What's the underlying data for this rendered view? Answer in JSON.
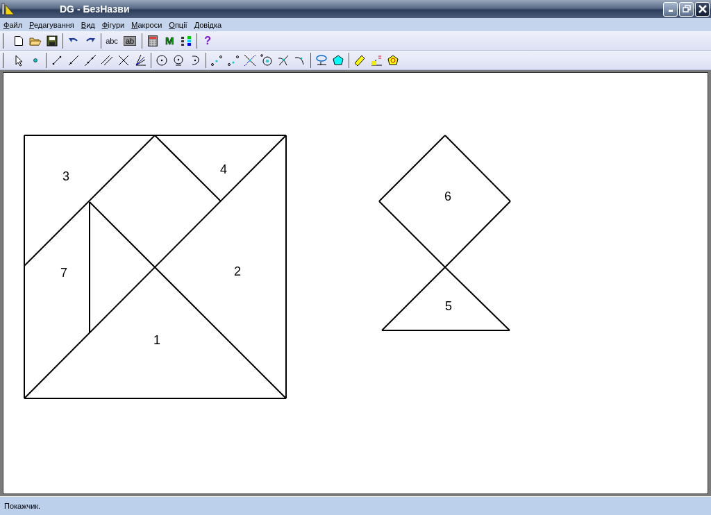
{
  "window": {
    "title": "DG - БезНазви"
  },
  "menu": [
    "Файл",
    "Редагування",
    "Вид",
    "Фігури",
    "Макроси",
    "Опції",
    "Довідка"
  ],
  "toolbar_1": [
    {
      "kind": "new"
    },
    {
      "kind": "open"
    },
    {
      "kind": "save"
    },
    {
      "kind": "sep"
    },
    {
      "kind": "undo"
    },
    {
      "kind": "redo"
    },
    {
      "kind": "sep"
    },
    {
      "kind": "text",
      "label": "abc"
    },
    {
      "kind": "textbox",
      "label": "ab"
    },
    {
      "kind": "sep"
    },
    {
      "kind": "calc"
    },
    {
      "kind": "letter",
      "label": "M"
    },
    {
      "kind": "fkeys"
    },
    {
      "kind": "sep"
    },
    {
      "kind": "help",
      "label": "?"
    }
  ],
  "toolbar_2": [
    {
      "kind": "pointer"
    },
    {
      "kind": "point"
    },
    {
      "kind": "sep"
    },
    {
      "kind": "segment"
    },
    {
      "kind": "ray"
    },
    {
      "kind": "line"
    },
    {
      "kind": "parallel"
    },
    {
      "kind": "perpendicular"
    },
    {
      "kind": "bisector"
    },
    {
      "kind": "sep"
    },
    {
      "kind": "circle"
    },
    {
      "kind": "circle-point"
    },
    {
      "kind": "arc"
    },
    {
      "kind": "sep"
    },
    {
      "kind": "points"
    },
    {
      "kind": "points2"
    },
    {
      "kind": "intersect"
    },
    {
      "kind": "center"
    },
    {
      "kind": "tangent"
    },
    {
      "kind": "curve"
    },
    {
      "kind": "sep"
    },
    {
      "kind": "trace"
    },
    {
      "kind": "polygon"
    },
    {
      "kind": "sep"
    },
    {
      "kind": "ruler"
    },
    {
      "kind": "angle-measure"
    },
    {
      "kind": "area-measure"
    }
  ],
  "canvas": {
    "labels": [
      "1",
      "2",
      "3",
      "4",
      "5",
      "6",
      "7"
    ]
  },
  "status_bar": "Покажчик."
}
